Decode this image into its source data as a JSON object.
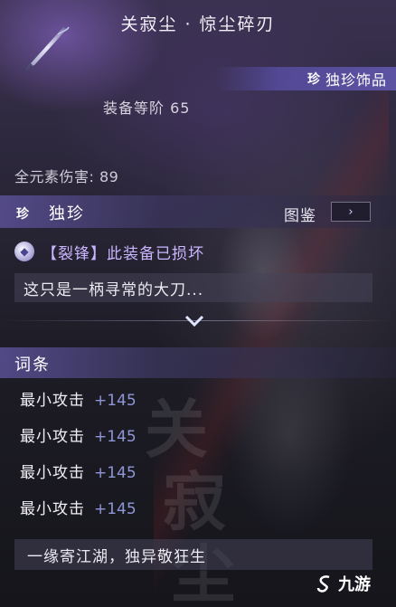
{
  "item": {
    "title": "关寂尘 · 惊尘碎刃",
    "rarity_badge": "珍",
    "rarity_label": "独珍饰品",
    "grade": "装备等阶 65",
    "element_damage": "全元素伤害: 89"
  },
  "rarity_section": {
    "badge": "珍",
    "title": "独珍",
    "atlas_label": "图鉴",
    "atlas_button_glyph": "›",
    "status_text": "【裂锋】此装备已损坏",
    "description": "这只是一柄寻常的大刀..."
  },
  "affix_section": {
    "title": "词条",
    "stats": [
      {
        "name": "最小攻击",
        "value": "+145"
      },
      {
        "name": "最小攻击",
        "value": "+145"
      },
      {
        "name": "最小攻击",
        "value": "+145"
      },
      {
        "name": "最小攻击",
        "value": "+145"
      }
    ]
  },
  "background_calligraphy": [
    "关",
    "寂",
    "尘"
  ],
  "flavor_quote": "一缘寄江湖，独异敬狂生",
  "watermark": {
    "logo_glyph": "S",
    "text": "九游"
  },
  "colors": {
    "accent_purple": "#5a50aa",
    "status_purple": "#c9b6ff",
    "stat_value_blue": "#8e96d8"
  },
  "icons": {
    "weapon": "blade-icon",
    "gem": "gem-icon",
    "expand": "chevron-down-icon"
  }
}
